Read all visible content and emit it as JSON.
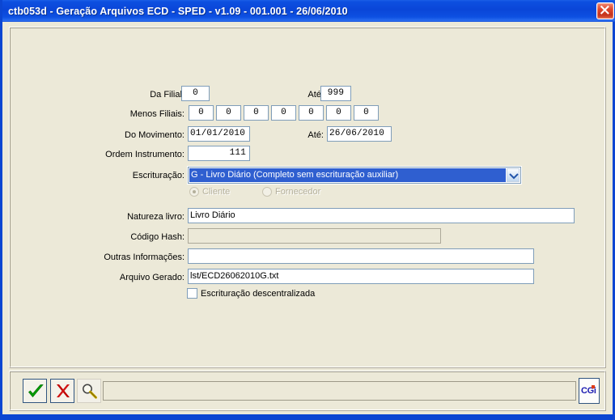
{
  "window": {
    "title": "ctb053d - Geração Arquivos ECD - SPED -  v1.09 - 001.001 - 26/06/2010",
    "close_icon": "close-icon",
    "titlebar_color": "#0a46d8",
    "client_color": "#ece9d8"
  },
  "form": {
    "da_filial": {
      "label": "Da Filial:",
      "value": "0",
      "ate_label": "Até:",
      "ate_value": "999"
    },
    "menos_filiais": {
      "label": "Menos Filiais:",
      "values": [
        "0",
        "0",
        "0",
        "0",
        "0",
        "0",
        "0"
      ]
    },
    "do_movimento": {
      "label": "Do Movimento:",
      "value": "01/01/2010",
      "ate_label": "Até:",
      "ate_value": "26/06/2010"
    },
    "ordem_instrumento": {
      "label": "Ordem Instrumento:",
      "value": "111"
    },
    "escrituracao": {
      "label": "Escrituração:",
      "selected": "G - Livro Diário (Completo sem escrituração auxiliar)",
      "dropdown_icon": "chevron-down-icon",
      "highlight_color": "#2f5fd0"
    },
    "tipo_pessoa": {
      "cliente_label": "Cliente",
      "fornecedor_label": "Fornecedor",
      "selected": "Cliente",
      "disabled": "true"
    },
    "natureza_livro": {
      "label": "Natureza livro:",
      "value": "Livro Diário"
    },
    "codigo_hash": {
      "label": "Código Hash:",
      "value": ""
    },
    "outras_informacoes": {
      "label": "Outras Informações:",
      "value": ""
    },
    "arquivo_gerado": {
      "label": "Arquivo Gerado:",
      "value": "lst/ECD26062010G.txt"
    },
    "escrituracao_descentralizada": {
      "label": "Escrituração descentralizada",
      "checked": "false"
    }
  },
  "toolbar": {
    "confirm_icon": "check-icon",
    "cancel_icon": "cancel-x-icon",
    "search_icon": "magnifier-icon",
    "status_message": "",
    "brand": {
      "text": "CGi",
      "color": "#1a1ab0",
      "accent_color": "#e03a12"
    }
  }
}
